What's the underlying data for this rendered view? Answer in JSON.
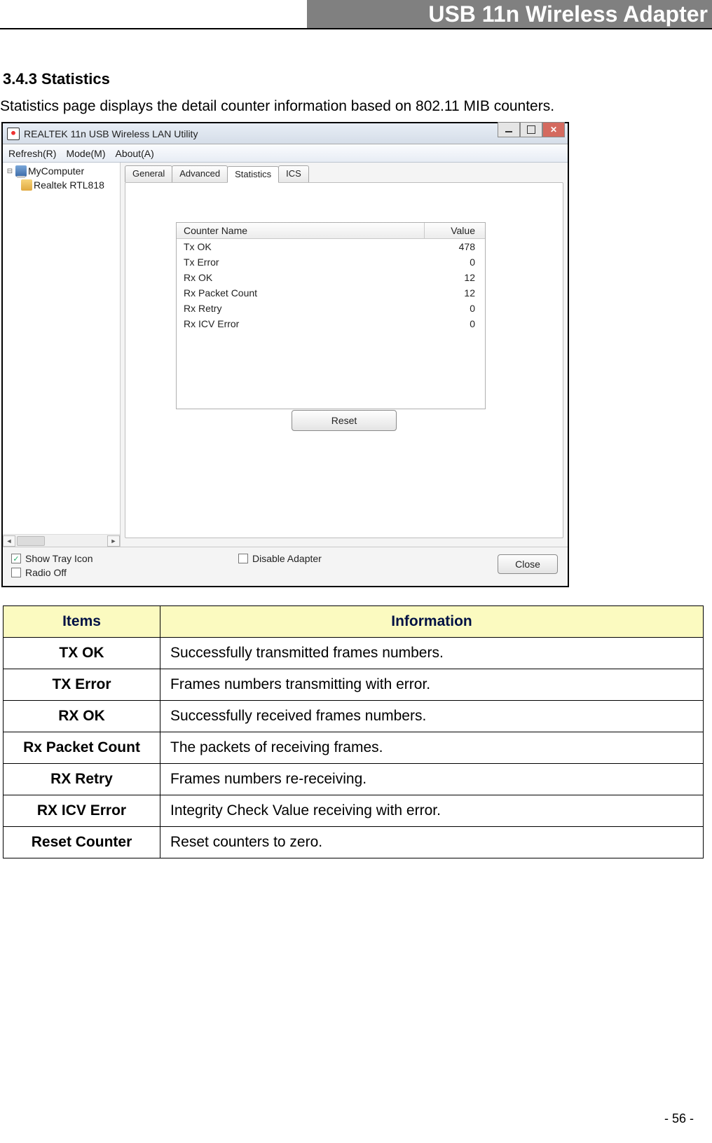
{
  "header_title": "USB 11n Wireless Adapter",
  "section_number": "3.4.3    Statistics",
  "section_desc": "Statistics page displays the detail counter information based on 802.11 MIB counters.",
  "window": {
    "title": "REALTEK 11n USB Wireless LAN Utility",
    "menu": {
      "refresh": "Refresh(R)",
      "mode": "Mode(M)",
      "about": "About(A)"
    },
    "tree": {
      "computer": "MyComputer",
      "adapter": "Realtek RTL818"
    },
    "tabs": {
      "general": "General",
      "advanced": "Advanced",
      "statistics": "Statistics",
      "ics": "ICS"
    },
    "table_headers": {
      "name": "Counter Name",
      "value": "Value"
    },
    "counters": [
      {
        "name": "Tx OK",
        "value": "478"
      },
      {
        "name": "Tx Error",
        "value": "0"
      },
      {
        "name": "Rx OK",
        "value": "12"
      },
      {
        "name": "Rx Packet Count",
        "value": "12"
      },
      {
        "name": "Rx Retry",
        "value": "0"
      },
      {
        "name": "Rx ICV Error",
        "value": "0"
      }
    ],
    "reset_label": "Reset",
    "footer": {
      "show_tray": "Show Tray Icon",
      "radio_off": "Radio Off",
      "disable_adapter": "Disable Adapter",
      "close": "Close"
    }
  },
  "info_table": {
    "headers": {
      "items": "Items",
      "information": "Information"
    },
    "rows": [
      {
        "item": "TX OK",
        "info": "Successfully transmitted frames numbers."
      },
      {
        "item": "TX Error",
        "info": "Frames numbers transmitting with error."
      },
      {
        "item": "RX OK",
        "info": "Successfully received frames numbers."
      },
      {
        "item": "Rx Packet Count",
        "info": "The packets of receiving frames."
      },
      {
        "item": "RX Retry",
        "info": "Frames numbers re-receiving."
      },
      {
        "item": "RX ICV Error",
        "info": "Integrity Check Value receiving with error."
      },
      {
        "item": "Reset Counter",
        "info": "Reset counters to zero."
      }
    ]
  },
  "page_number": "- 56 -"
}
